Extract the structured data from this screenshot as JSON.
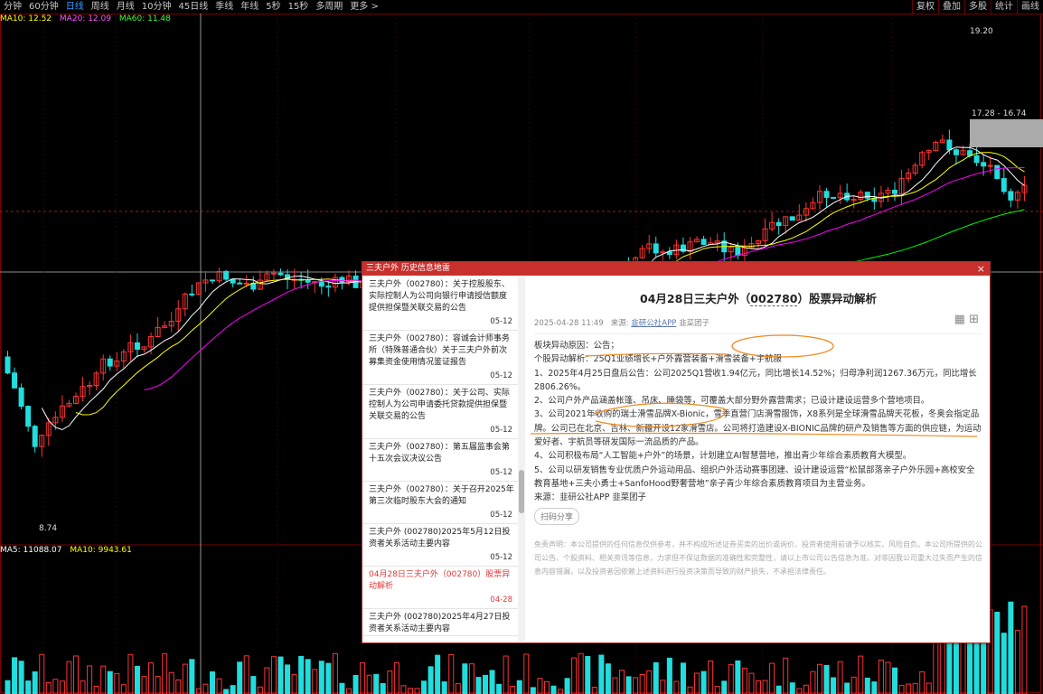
{
  "toolbar": {
    "periods": [
      "分钟",
      "60分钟",
      "日线",
      "周线",
      "月线",
      "10分钟",
      "45日线",
      "季线",
      "年线",
      "5秒",
      "15秒",
      "多周期",
      "更多 >"
    ],
    "active_period": "日线",
    "right_buttons": [
      "复权",
      "叠加",
      "多股",
      "统计",
      "画线"
    ]
  },
  "ma": {
    "ma10": "MA10: 12.52",
    "ma20": "MA20: 12.09",
    "ma60": "MA60: 11.48"
  },
  "volume": {
    "ma5": "MA5: 11088.07",
    "ma10": "MA10: 9943.61"
  },
  "price_labels": {
    "high": "19.20",
    "range": "17.28 - 16.74",
    "low": "8.74"
  },
  "colors": {
    "up": "#ff3333",
    "down": "#22dddd",
    "ma5": "#ffffff",
    "ma10": "#ffff00",
    "ma20": "#ff00ff",
    "ma60": "#00ff00",
    "dialog_title_bg": "#c8302c",
    "annotation": "#f08a1e"
  },
  "dialog": {
    "title": "三夫户外 历史信息地雷",
    "close_icon": "×",
    "list": [
      {
        "text": "三夫户外（002780）：关于控股股东、实际控制人为公司向银行申请授信额度提供担保暨关联交易的公告",
        "date": "05-12"
      },
      {
        "text": "三夫户外（002780）：容诚会计师事务所（特殊普通合伙）关于三夫户外前次募集资金使用情况鉴证报告",
        "date": "05-12"
      },
      {
        "text": "三夫户外（002780）：关于公司、实际控制人为公司申请委托贷款提供担保暨关联交易的公告",
        "date": "05-12"
      },
      {
        "text": "三夫户外（002780）：第五届监事会第十五次会议决议公告",
        "date": "05-12"
      },
      {
        "text": "三夫户外（002780）：关于召开2025年第三次临时股东大会的通知",
        "date": "05-12"
      },
      {
        "text": "三夫户外 (002780)2025年5月12日投资者关系活动主要内容",
        "date": "05-12"
      },
      {
        "text": "04月28日三夫户外（002780）股票异动解析",
        "date": "04-28"
      },
      {
        "text": "三夫户外 (002780)2025年4月27日投资者关系活动主要内容",
        "date": ""
      }
    ],
    "article": {
      "title_pre": "04月28日三夫户外（",
      "title_code": "002780",
      "title_post": "）股票异动解析",
      "date": "2025-04-28 11:49",
      "source_label": "来源:",
      "source_link": "韭研公社APP",
      "author": "韭菜团子",
      "paragraphs": [
        "板块异动原因：公告；",
        "个股异动解析：25Q1业绩增长+户外露营装备+滑雪装备+宇航服",
        "1、2025年4月25日盘后公告：公司2025Q1营收1.94亿元，同比增长14.52%；归母净利润1267.36万元，同比增长2806.26%。",
        "2、公司户外产品涵盖帐篷、吊床、睡袋等，可覆盖大部分野外露营需求；已设计建设运营多个营地项目。",
        "3、公司2021年收购的瑞士滑雪品牌X-Bionic，雪季直营门店滑雪服饰，X8系列是全球滑雪品牌天花板，冬奥会指定品牌。公司已在北京、吉林、新疆开设12家滑雪店。公司将打造建设X-BIONIC品牌的研产及销售等方面的供应链，为运动爱好者、宇航员等研发国际一流品质的产品。",
        "4、公司积极布局“人工智能+户外”的场景，计划建立AI智慧营地，推出青少年综合素质教育大模型。",
        "5、公司以研发销售专业优质户外运动用品、组织户外活动赛事团建、设计建设运营“松鼠部落亲子户外乐园+高校安全教育基地+三夫小勇士+SanfoHood野奢营地”亲子青少年综合素质教育项目为主营业务。",
        "来源：韭研公社APP 韭菜团子"
      ],
      "share_label": "扫码分享",
      "disclaimer": "免责声明：本公司提供的任何信息仅供参考，并不构成所述证券买卖的出价或询价，投资者使用前请予以核实，风险自负。本公司所提供的公司公告、个股资料、相关资讯等信息，力求但不保证数据的准确性和完整性，请以上市公司公告信息为准。对非因我公司重大过失而产生的信息内容错漏，以及投资者因依赖上述资料进行投资决策而导致的财产损失，不承担法律责任。"
    }
  }
}
